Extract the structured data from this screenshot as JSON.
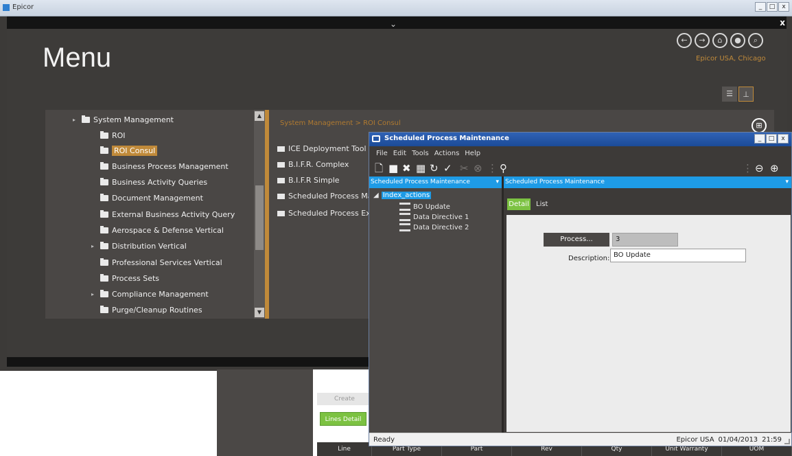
{
  "main_window": {
    "title": "Epicor",
    "menu_title": "Menu",
    "company": "Epicor USA, Chicago",
    "window_buttons": [
      "_",
      "□",
      "x"
    ],
    "close_glyph": "x"
  },
  "tree": {
    "items": [
      {
        "label": "System Management",
        "level": 0,
        "expander": "▸"
      },
      {
        "label": "ROI",
        "level": 1
      },
      {
        "label": "ROI Consul",
        "level": 1,
        "selected": true
      },
      {
        "label": "Business Process Management",
        "level": 1
      },
      {
        "label": "Business Activity Queries",
        "level": 1
      },
      {
        "label": "Document Management",
        "level": 1
      },
      {
        "label": "External Business Activity Query",
        "level": 1
      },
      {
        "label": "Aerospace & Defense Vertical",
        "level": 1
      },
      {
        "label": "Distribution Vertical",
        "level": 1,
        "expander": "▸"
      },
      {
        "label": "Professional Services Vertical",
        "level": 1
      },
      {
        "label": "Process Sets",
        "level": 1
      },
      {
        "label": "Compliance Management",
        "level": 1,
        "expander": "▸"
      },
      {
        "label": "Purge/Cleanup Routines",
        "level": 1
      }
    ]
  },
  "list_panel": {
    "breadcrumb": "System Management > ROI Consul",
    "items": [
      {
        "label": "ICE Deployment Tool"
      },
      {
        "label": "B.I.F.R. Complex"
      },
      {
        "label": "B.I.F.R Simple"
      },
      {
        "label": "Scheduled Process Ma"
      },
      {
        "label": "Scheduled Process Ex"
      }
    ]
  },
  "background": {
    "tab_label": "Create",
    "lines_tab": "Lines Detail",
    "grid_cols": [
      "Line",
      "Part Type",
      "Part",
      "Rev",
      "Qty",
      "Unit Warranty",
      "UOM"
    ]
  },
  "dialog": {
    "title": "Scheduled Process Maintenance",
    "menu": [
      "File",
      "Edit",
      "Tools",
      "Actions",
      "Help"
    ],
    "left_header": "Scheduled Process Maintenance",
    "right_header": "Scheduled Process Maintenance",
    "tree_root": "Index_actions",
    "tree_children": [
      "BO Update",
      "Data Directive 1",
      "Data Directive 2"
    ],
    "tabs": {
      "detail": "Detail",
      "list": "List"
    },
    "form": {
      "process_button": "Process...",
      "process_value": "3",
      "description_label": "Description:",
      "description_value": "BO Update"
    },
    "status": {
      "ready": "Ready",
      "company": "Epicor USA",
      "date": "01/04/2013",
      "time": "21:59"
    }
  }
}
